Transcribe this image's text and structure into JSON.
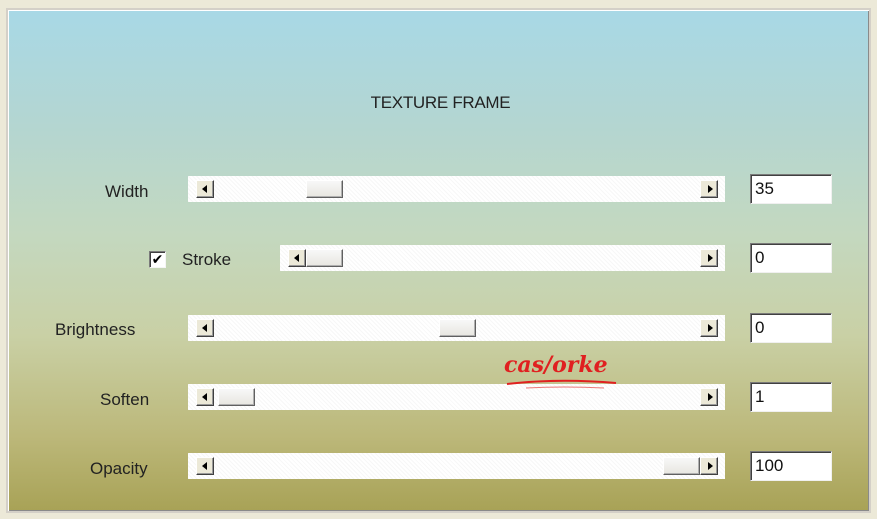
{
  "dialog": {
    "title": "TEXTURE FRAME"
  },
  "controls": [
    {
      "key": "width",
      "label": "Width",
      "value": "35",
      "slider_fraction": 0.206
    },
    {
      "key": "stroke",
      "label": "Stroke",
      "value": "0",
      "checked": true,
      "check_glyph": "✔",
      "slider_fraction": 0.0
    },
    {
      "key": "brightness",
      "label": "Brightness",
      "value": "0",
      "slider_fraction": 0.5
    },
    {
      "key": "soften",
      "label": "Soften",
      "value": "1",
      "slider_fraction": 0.01
    },
    {
      "key": "opacity",
      "label": "Opacity",
      "value": "100",
      "slider_fraction": 1.0
    }
  ],
  "watermark": {
    "text": "castorke",
    "color": "#e02020"
  },
  "icons": {
    "scroll_left": "triangle-left-icon",
    "scroll_right": "triangle-right-icon"
  }
}
